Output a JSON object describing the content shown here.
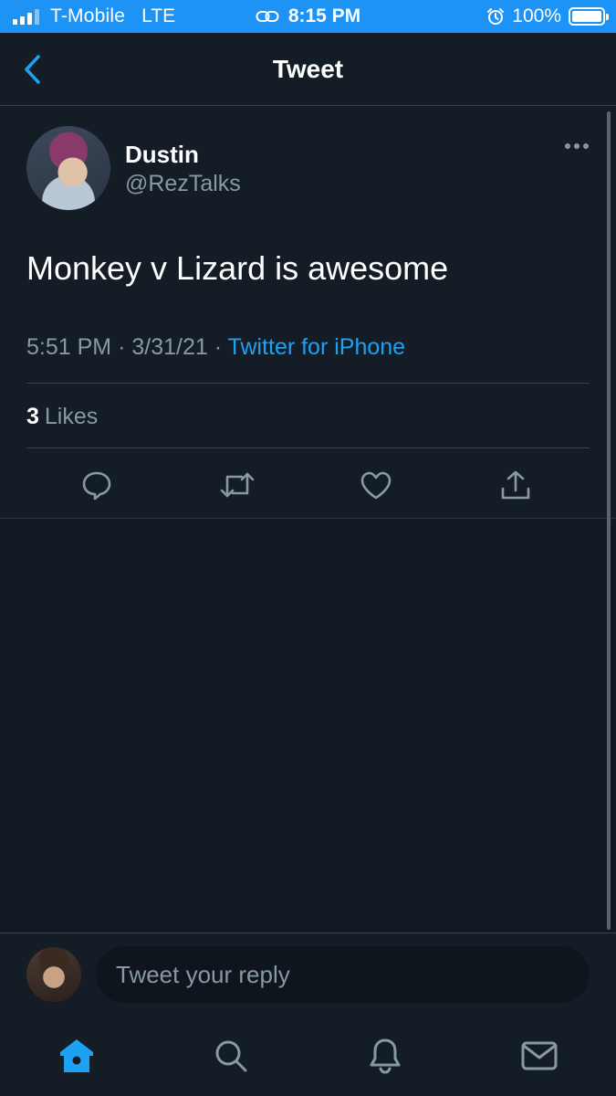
{
  "status_bar": {
    "carrier": "T-Mobile",
    "network": "LTE",
    "time": "8:15 PM",
    "battery": "100%",
    "battery_level": 1.0
  },
  "nav": {
    "title": "Tweet",
    "back_icon": "chevron-left-icon"
  },
  "tweet": {
    "author_name": "Dustin",
    "author_handle": "@RezTalks",
    "text": "Monkey v Lizard is awesome",
    "time": "5:51 PM",
    "date": "3/31/21",
    "separator": "·",
    "source": "Twitter for iPhone",
    "likes_count": "3",
    "likes_label": "Likes",
    "actions": [
      "reply-icon",
      "retweet-icon",
      "like-icon",
      "share-icon"
    ]
  },
  "reply": {
    "placeholder": "Tweet your reply"
  },
  "tab_bar": {
    "tabs": [
      "home-icon",
      "search-icon",
      "notifications-icon",
      "messages-icon"
    ],
    "active": "home-icon"
  },
  "colors": {
    "accent": "#1da1f2",
    "background": "#141d26",
    "muted_text": "#8899a6",
    "divider": "#38444d"
  }
}
